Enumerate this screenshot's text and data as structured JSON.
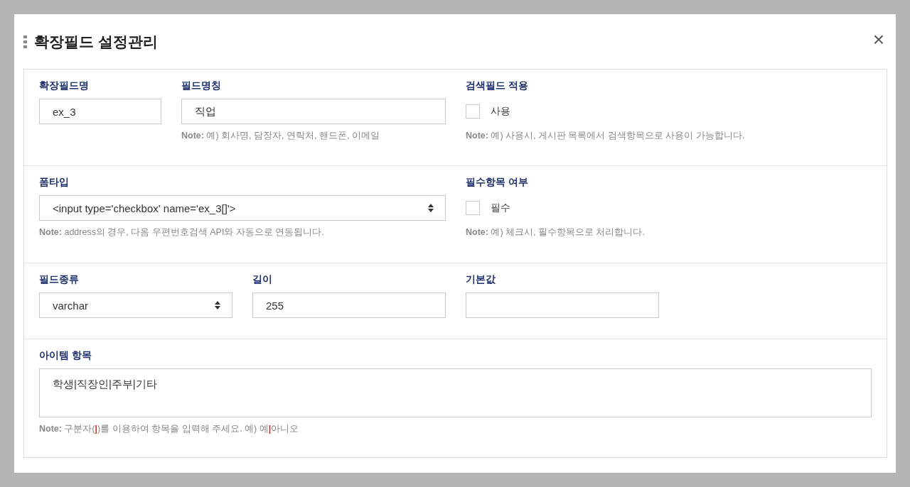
{
  "dialog": {
    "title": "확장필드 설정관리",
    "close": "×"
  },
  "rows": [
    {
      "fields": [
        {
          "kind": "text",
          "label": "확장필드명",
          "value": "ex_3"
        },
        {
          "kind": "text",
          "label": "필드명칭",
          "value": "직업",
          "note": [
            {
              "kind": "label",
              "text": "Note:"
            },
            {
              "kind": "plain",
              "text": " 예) 회사명, 담장자, 연락처, 핸드폰, 이메일"
            }
          ]
        },
        {
          "kind": "checkbox",
          "label": "검색필드 적용",
          "option": "사용",
          "checked": false,
          "note": [
            {
              "kind": "label",
              "text": "Note:"
            },
            {
              "kind": "plain",
              "text": " 예) 사용시, 게시판 목록에서 검색항목으로 사용이 가능합니다."
            }
          ]
        }
      ]
    },
    {
      "fields": [
        {
          "kind": "select",
          "label": "폼타입",
          "value": "<input type='checkbox' name='ex_3[]'>",
          "note": [
            {
              "kind": "label",
              "text": "Note:"
            },
            {
              "kind": "plain",
              "text": " address의 경우, 다음 우편번호검색 API와 자동으로 연동됩니다."
            }
          ]
        },
        {
          "kind": "checkbox",
          "label": "필수항목 여부",
          "option": "필수",
          "checked": false,
          "note": [
            {
              "kind": "label",
              "text": "Note:"
            },
            {
              "kind": "plain",
              "text": " 예) 체크시, 필수항목으로 처리합니다."
            }
          ]
        }
      ]
    },
    {
      "fields": [
        {
          "kind": "select",
          "label": "필드종류",
          "value": "varchar"
        },
        {
          "kind": "text",
          "label": "길이",
          "value": "255"
        },
        {
          "kind": "text",
          "label": "기본값"
        }
      ]
    },
    {
      "fields": [
        {
          "kind": "textarea",
          "label": "아이템 항목",
          "value": "학생|직장인|주부|기타",
          "note": [
            {
              "kind": "label",
              "text": "Note:"
            },
            {
              "kind": "plain",
              "text": " 구분자("
            },
            {
              "kind": "mark",
              "text": "|"
            },
            {
              "kind": "plain",
              "text": ")를 이용하여 항목을 입력해 주세요. 예) 예"
            },
            {
              "kind": "mark",
              "text": "|"
            },
            {
              "kind": "plain",
              "text": "아니오"
            }
          ]
        }
      ]
    }
  ]
}
